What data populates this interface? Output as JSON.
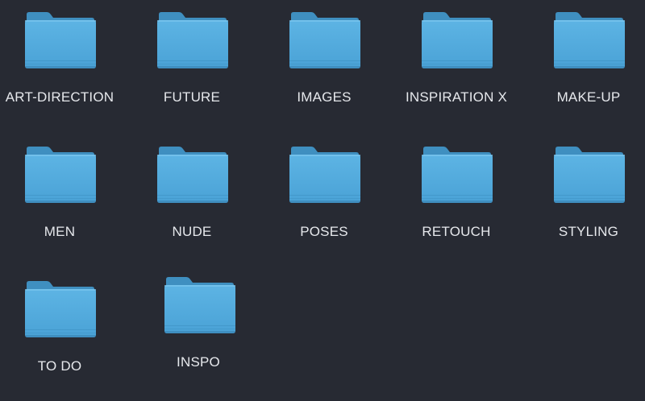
{
  "desktop": {
    "folders": [
      {
        "label": "ART-DIRECTION",
        "icon": "folder-icon"
      },
      {
        "label": "FUTURE",
        "icon": "folder-icon"
      },
      {
        "label": "IMAGES",
        "icon": "folder-icon"
      },
      {
        "label": "INSPIRATION X",
        "icon": "folder-icon"
      },
      {
        "label": "MAKE-UP",
        "icon": "folder-icon"
      },
      {
        "label": "MEN",
        "icon": "folder-icon"
      },
      {
        "label": "NUDE",
        "icon": "folder-icon"
      },
      {
        "label": "POSES",
        "icon": "folder-icon"
      },
      {
        "label": "RETOUCH",
        "icon": "folder-icon"
      },
      {
        "label": "STYLING",
        "icon": "folder-icon"
      },
      {
        "label": "TO DO",
        "icon": "folder-icon"
      },
      {
        "label": "INSPO",
        "icon": "folder-icon"
      }
    ]
  },
  "colors": {
    "background": "#272a33",
    "folder_front": "#5db4e4",
    "folder_back": "#3f8fc0",
    "label_text": "#e6e8ec"
  }
}
